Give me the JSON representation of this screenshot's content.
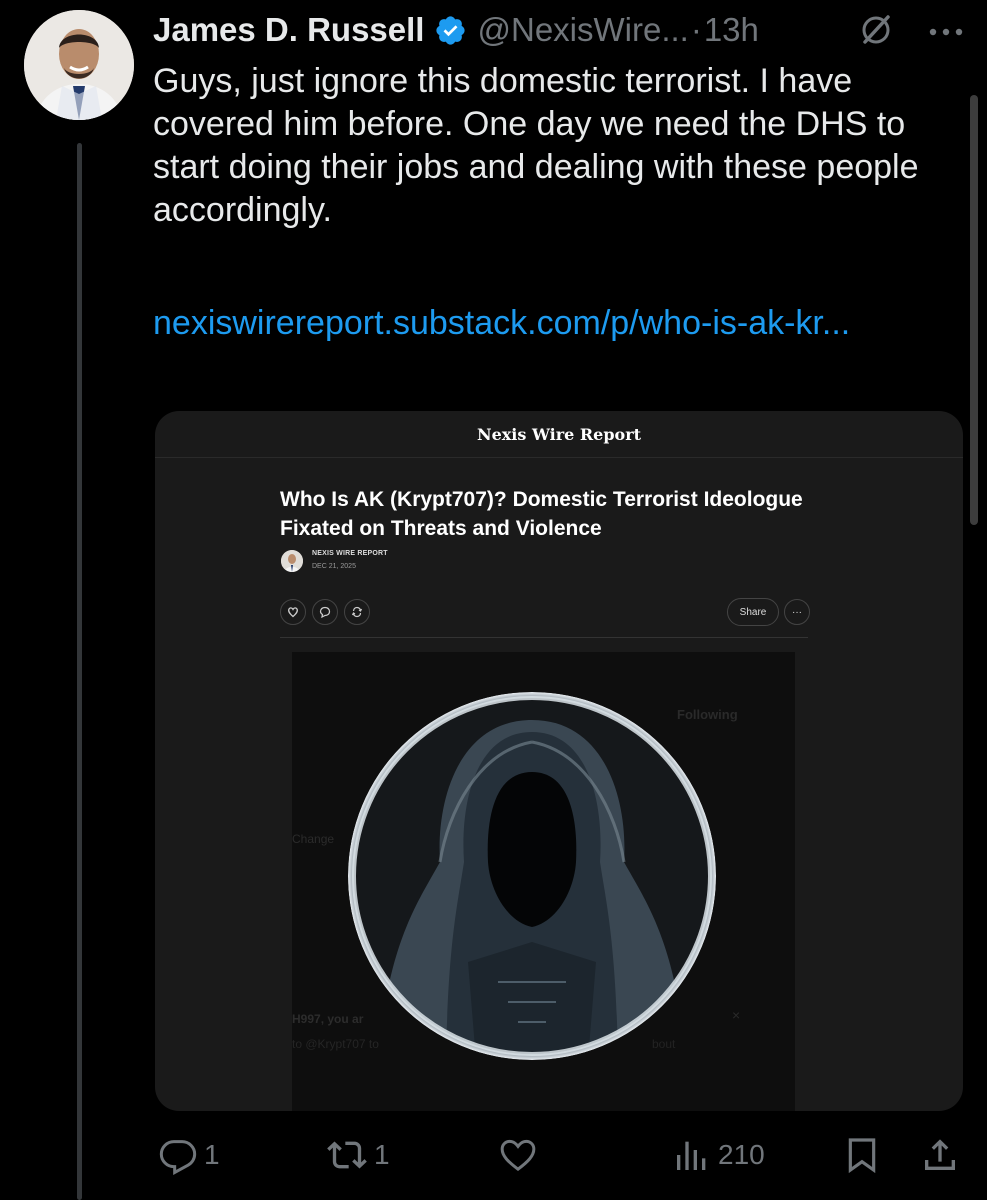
{
  "author": {
    "name": "James D. Russell",
    "handle": "@NexisWire...",
    "separator": "·",
    "time": "13h"
  },
  "icons": {
    "verified": "verified-badge-icon",
    "grok": "grok-icon",
    "more": "more-dots-icon",
    "reply": "reply-icon",
    "repost": "repost-icon",
    "like": "like-icon",
    "views": "views-icon",
    "bookmark": "bookmark-icon",
    "share": "share-icon"
  },
  "tweet": {
    "paragraphs": [
      "Guys, just ignore this domestic terrorist. I have covered him before.  One day we need the DHS to start doing their jobs and dealing with these people accordingly."
    ],
    "link": "nexiswirereport.substack.com/p/who-is-ak-kr..."
  },
  "card": {
    "publication": "Nexis Wire Report",
    "title": "Who Is AK (Krypt707)? Domestic Terrorist Ideologue Fixated on Threats and Violence",
    "byline_author": "NEXIS WIRE REPORT",
    "byline_date": "DEC 21, 2025",
    "share_label": "Share",
    "more_label": "···",
    "screenshot_texts": {
      "following": "Following",
      "change": "Change",
      "line1": "H997, you ar",
      "line2": "to @Krypt707 to",
      "line3": "bout",
      "close": "×"
    }
  },
  "engagement": {
    "replies": "1",
    "reposts": "1",
    "likes": "",
    "views": "210"
  },
  "colors": {
    "background": "#000000",
    "text": "#e7e9ea",
    "muted": "#71767b",
    "link": "#1d9bf0",
    "verified": "#1d9bf0"
  }
}
